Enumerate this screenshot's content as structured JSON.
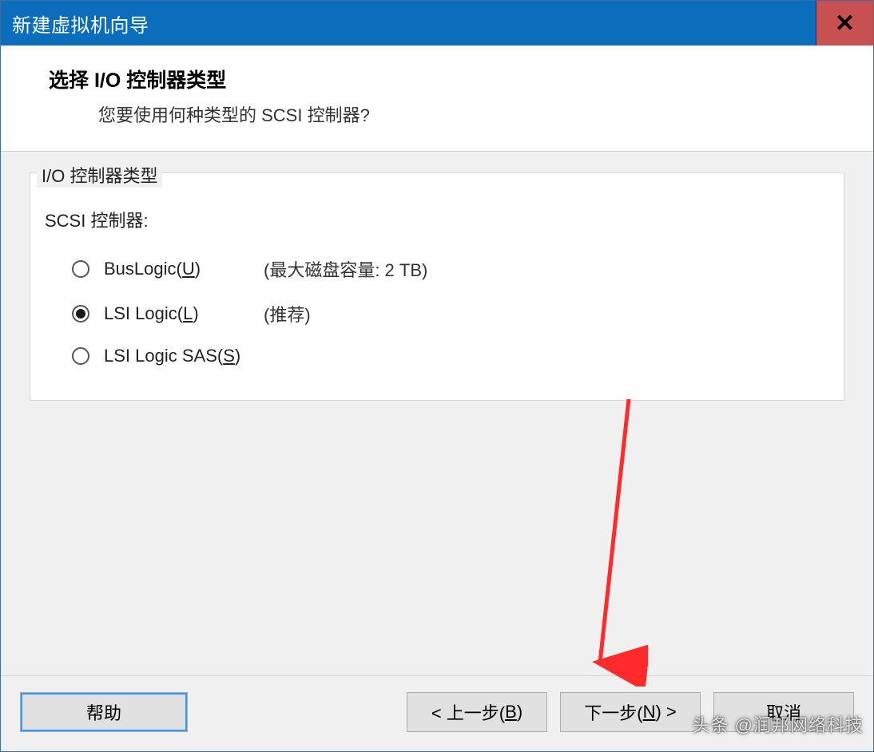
{
  "window": {
    "title": "新建虚拟机向导",
    "close_glyph": "✕"
  },
  "header": {
    "heading": "选择 I/O 控制器类型",
    "subheading": "您要使用何种类型的 SCSI 控制器?"
  },
  "group": {
    "legend": "I/O 控制器类型",
    "label": "SCSI 控制器:"
  },
  "options": [
    {
      "label_pre": "BusLogic(",
      "hotkey": "U",
      "label_post": ")",
      "note": "(最大磁盘容量: 2 TB)",
      "selected": false
    },
    {
      "label_pre": "LSI Logic(",
      "hotkey": "L",
      "label_post": ")",
      "note": "(推荐)",
      "selected": true
    },
    {
      "label_pre": "LSI Logic SAS(",
      "hotkey": "S",
      "label_post": ")",
      "note": "",
      "selected": false
    }
  ],
  "buttons": {
    "help": "帮助",
    "back_pre": "< 上一步(",
    "back_key": "B",
    "back_post": ")",
    "next_pre": "下一步(",
    "next_key": "N",
    "next_post": ") >",
    "cancel": "取消"
  },
  "watermark": "头条 @润邦网络科技"
}
